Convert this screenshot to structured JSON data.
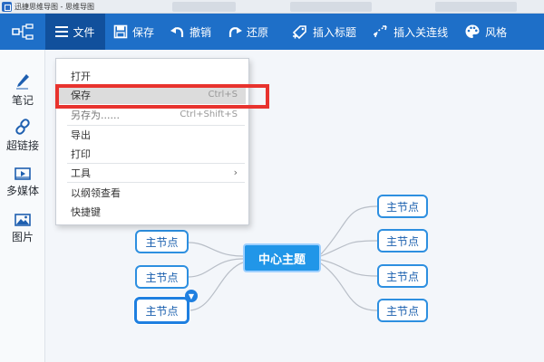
{
  "window": {
    "title": "迅捷思维导图 - 思维导图"
  },
  "toolbar": {
    "file_label": "文件",
    "buttons": [
      {
        "label": "保存",
        "icon": "save-icon"
      },
      {
        "label": "撤销",
        "icon": "undo-icon"
      },
      {
        "label": "还原",
        "icon": "redo-icon"
      },
      {
        "label": "插入标题",
        "icon": "insert-title-icon"
      },
      {
        "label": "插入关连线",
        "icon": "insert-link-line-icon"
      },
      {
        "label": "风格",
        "icon": "palette-icon"
      }
    ]
  },
  "sidebar": {
    "items": [
      {
        "label": "笔记",
        "icon": "pencil-icon"
      },
      {
        "label": "超链接",
        "icon": "link-icon"
      },
      {
        "label": "多媒体",
        "icon": "video-icon"
      },
      {
        "label": "图片",
        "icon": "image-icon"
      }
    ]
  },
  "file_menu": {
    "open": {
      "label": "打开"
    },
    "save": {
      "label": "保存",
      "shortcut": "Ctrl+S"
    },
    "save_as": {
      "label": "另存为......",
      "shortcut": "Ctrl+Shift+S"
    },
    "export": {
      "label": "导出"
    },
    "print": {
      "label": "打印"
    },
    "tools": {
      "label": "工具",
      "arrow": "›"
    },
    "outline": {
      "label": "以纲领查看"
    },
    "shortcuts": {
      "label": "快捷键"
    }
  },
  "mindmap": {
    "center": "中心主题",
    "left_nodes": [
      "主节点",
      "主节点",
      "主节点"
    ],
    "right_nodes": [
      "主节点",
      "主节点",
      "主节点",
      "主节点"
    ],
    "selected_toggle": "▼"
  },
  "colors": {
    "toolbar_bg": "#1e6fc8",
    "file_tab_bg": "#11509c",
    "center_node": "#2196e8",
    "node_border": "#2d8fe0",
    "highlight": "#e8332e"
  }
}
